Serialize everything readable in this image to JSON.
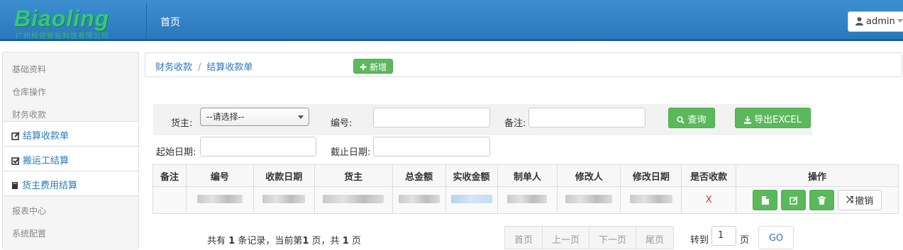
{
  "brand": {
    "logo_text": "Biaoling",
    "logo_subtitle": "广州标领智能科技有限公司"
  },
  "header": {
    "nav_home": "首页",
    "user": "admin"
  },
  "sidebar": {
    "headings": [
      "基础资料",
      "仓库操作",
      "财务收款",
      "报表中心",
      "系统配置"
    ],
    "items": [
      {
        "label": "结算收款单",
        "icon": "edit-icon"
      },
      {
        "label": "搬运工结算",
        "icon": "check-square-icon"
      },
      {
        "label": "货主费用结算",
        "icon": "book-icon"
      }
    ]
  },
  "breadcrumb": {
    "parent": "财务收款",
    "separator": "/",
    "current": "结算收款单",
    "add_button": "新增"
  },
  "filters": {
    "owner_label": "货主:",
    "owner_selected": "--请选择--",
    "number_label": "编号:",
    "number_value": "",
    "remark_label": "备注:",
    "remark_value": "",
    "query_button": "查询",
    "export_button": "导出EXCEL",
    "start_label": "起始日期:",
    "start_value": "",
    "end_label": "截止日期:",
    "end_value": ""
  },
  "table": {
    "headers": [
      "备注",
      "编号",
      "收款日期",
      "货主",
      "总金额",
      "实收金额",
      "制单人",
      "修改人",
      "修改日期",
      "是否收款",
      "操作"
    ],
    "row": {
      "received": "X",
      "cancel_button": "撤销"
    }
  },
  "pagination": {
    "info_prefix": "共有",
    "total": "1",
    "info_mid": "条记录，当前第",
    "current": "1",
    "info_mid2": "页，共",
    "pages": "1",
    "info_suffix": "页",
    "first": "首页",
    "prev": "上一页",
    "next": "下一页",
    "last": "尾页",
    "goto_label": "转到",
    "goto_value": "1",
    "goto_unit": "页",
    "go_button": "GO"
  },
  "colors": {
    "header": "#2a78bd",
    "accent_green": "#5cb85c",
    "link": "#2a78bd",
    "logo": "#34c87a"
  }
}
